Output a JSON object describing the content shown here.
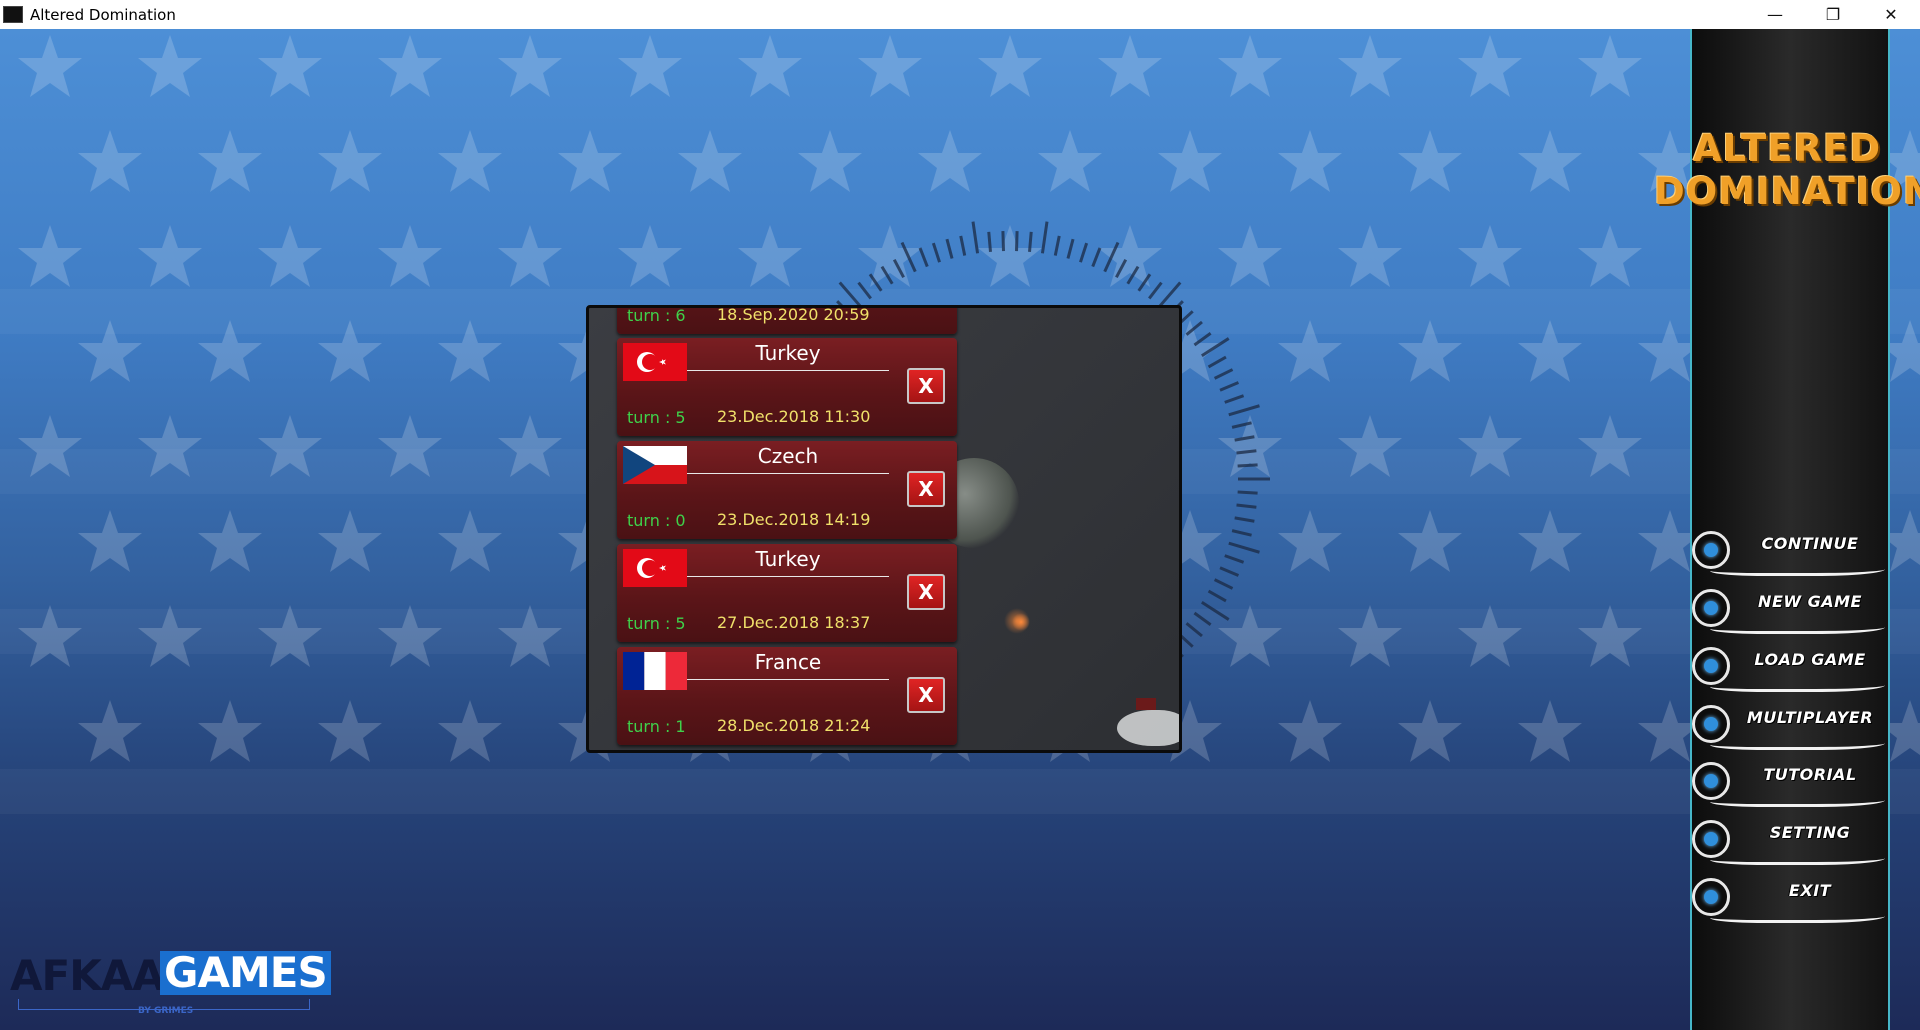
{
  "window": {
    "title": "Altered Domination",
    "minimize": "—",
    "restore": "❐",
    "close": "✕"
  },
  "game_logo": {
    "line1": "ALTERED",
    "line2": "DOMINATION"
  },
  "saves": [
    {
      "country": "",
      "turn": "turn : 6",
      "date": "18.Sep.2020 20:59",
      "flag": "usa"
    },
    {
      "country": "Turkey",
      "turn": "turn : 5",
      "date": "23.Dec.2018 11:30",
      "flag": "turkey",
      "delete": "X"
    },
    {
      "country": "Czech",
      "turn": "turn : 0",
      "date": "23.Dec.2018 14:19",
      "flag": "czech",
      "delete": "X"
    },
    {
      "country": "Turkey",
      "turn": "turn : 5",
      "date": "27.Dec.2018 18:37",
      "flag": "turkey",
      "delete": "X"
    },
    {
      "country": "France",
      "turn": "turn : 1",
      "date": "28.Dec.2018 21:24",
      "flag": "france",
      "delete": "X"
    }
  ],
  "menu": [
    {
      "label": "CONTINUE"
    },
    {
      "label": "NEW GAME"
    },
    {
      "label": "LOAD GAME"
    },
    {
      "label": "MULTIPLAYER"
    },
    {
      "label": "TUTORIAL"
    },
    {
      "label": "SETTING"
    },
    {
      "label": "EXIT"
    }
  ],
  "publisher": {
    "part1": "AFKAAR",
    "part2": "GAMES",
    "by": "BY GRIMES"
  },
  "colors": {
    "turn_text": "#3fd14a",
    "date_text": "#f0e06a",
    "logo_orange": "#f0a028",
    "sidebar_border": "#46b6c8"
  }
}
